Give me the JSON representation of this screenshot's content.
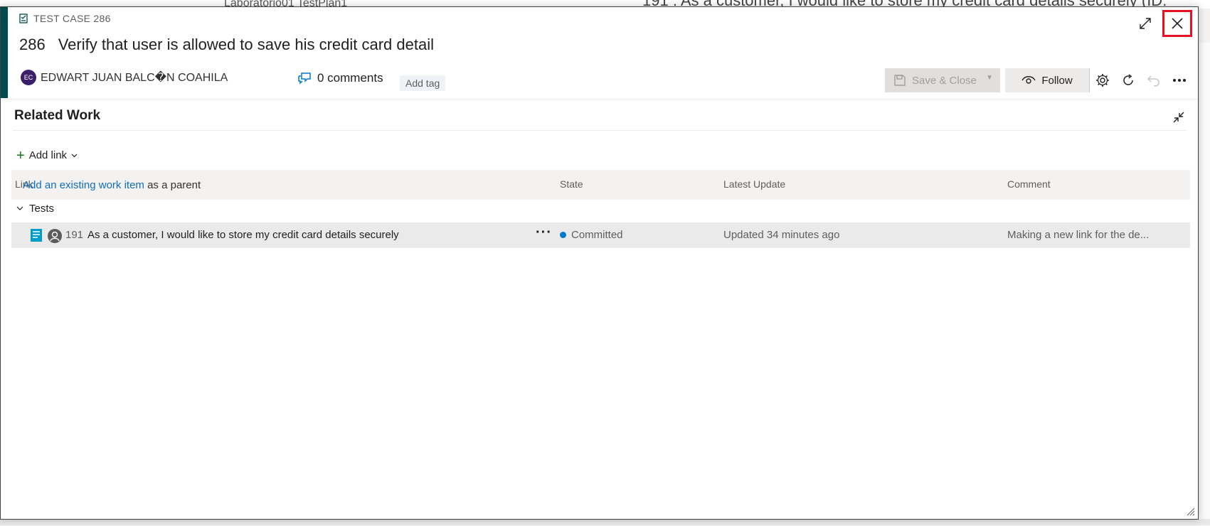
{
  "background": {
    "tab_text": "Laboratorio01 TestPlan1",
    "page_title": "191 : As a customer, I would like to store my credit card details securely (ID:"
  },
  "dialog": {
    "type_label": "TEST CASE 286",
    "id": "286",
    "title": "Verify that user is allowed to save his credit card detail",
    "assignee_initials": "EC",
    "assignee_name": "EDWART JUAN BALC�N COAHILA",
    "comments_label": "0 comments",
    "add_tag_label": "Add tag",
    "save_close_label": "Save & Close",
    "follow_label": "Follow"
  },
  "related_work": {
    "title": "Related Work",
    "add_link_label": "Add link",
    "columns": {
      "link": "Link",
      "state": "State",
      "latest_update": "Latest Update",
      "comment": "Comment"
    },
    "hint_link_text": "Add an existing work item",
    "hint_suffix": " as a parent",
    "groups": [
      {
        "name": "Tests",
        "items": [
          {
            "id": "191",
            "title": "As a customer, I would like to store my credit card details securely",
            "state": "Committed",
            "latest_update": "Updated 34 minutes ago",
            "comment": "Making a new link for the de..."
          }
        ]
      }
    ]
  },
  "colors": {
    "accent": "#004b50",
    "link": "#106ebe",
    "state_committed": "#007acc",
    "close_highlight": "#e81123"
  }
}
